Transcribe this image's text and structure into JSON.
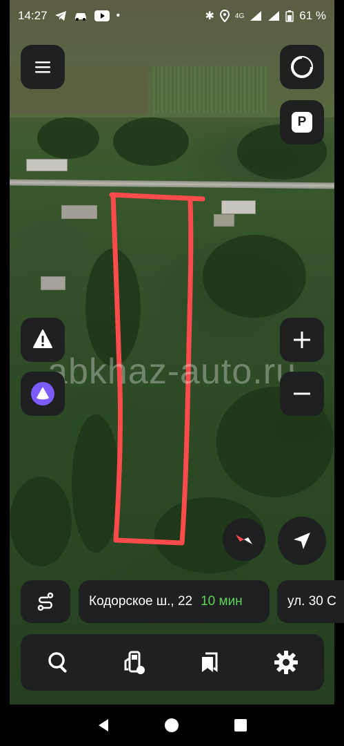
{
  "status_bar": {
    "time": "14:27",
    "network": "4G",
    "battery": "61 %"
  },
  "map": {
    "watermark": "abkhaz-auto.ru",
    "parking_label": "P"
  },
  "route_pills": [
    {
      "address": "Кодорское ш., 22",
      "eta": "10 мин"
    },
    {
      "address": "ул. 30 С"
    }
  ],
  "colors": {
    "eta_green": "#5fd35a",
    "button_bg": "#1f2022",
    "outline_red": "#ff4b4b",
    "alice_purple": "#7b5cff"
  },
  "icons": {
    "menu": "menu-icon",
    "layers": "layers-icon",
    "parking": "parking-icon",
    "alert": "road-event-icon",
    "alice": "alice-assistant-icon",
    "zoom_in": "plus-icon",
    "zoom_out": "minus-icon",
    "compass": "compass-icon",
    "locate": "navigation-arrow-icon",
    "route": "route-icon",
    "search": "search-icon",
    "gas": "gas-station-icon",
    "bookmarks": "bookmarks-icon",
    "settings": "gear-icon"
  }
}
